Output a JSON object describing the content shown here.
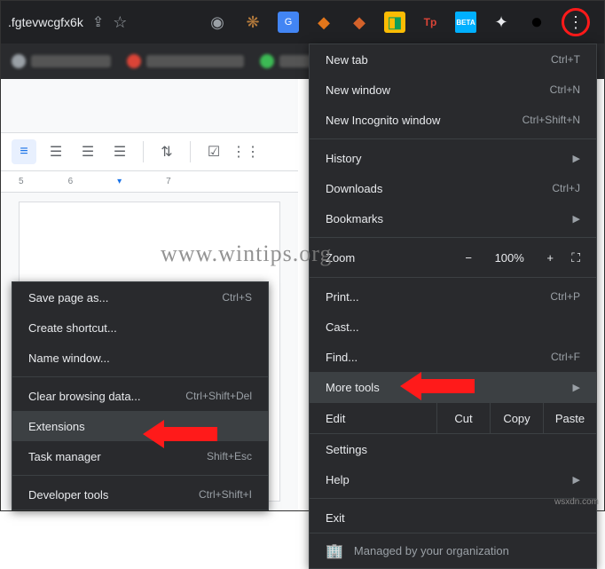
{
  "url": ".fgtevwcgfx6k",
  "extensions": [
    {
      "name": "camera-icon",
      "glyph": "📷",
      "color": "#9aa0a6"
    },
    {
      "name": "cookie-icon",
      "glyph": "🍪",
      "color": "#b57b3c"
    },
    {
      "name": "translate-icon",
      "glyph": "🔤",
      "color": "#4285f4"
    },
    {
      "name": "fox-icon",
      "glyph": "🦊",
      "color": "#e2761b"
    },
    {
      "name": "fox2-icon",
      "glyph": "🦊",
      "color": "#e2761b"
    },
    {
      "name": "mail-icon",
      "glyph": "✉",
      "color": "#0f9d58"
    },
    {
      "name": "tp-icon",
      "glyph": "Tp",
      "color": "#db4437"
    },
    {
      "name": "beta-icon",
      "glyph": "BETA",
      "color": "#00b0ff"
    },
    {
      "name": "puzzle-icon",
      "glyph": "✦",
      "color": "#e8eaed"
    },
    {
      "name": "profile-icon",
      "glyph": "●",
      "color": "#000"
    }
  ],
  "menu": {
    "new_tab": {
      "label": "New tab",
      "shortcut": "Ctrl+T"
    },
    "new_window": {
      "label": "New window",
      "shortcut": "Ctrl+N"
    },
    "new_incognito": {
      "label": "New Incognito window",
      "shortcut": "Ctrl+Shift+N"
    },
    "history": {
      "label": "History"
    },
    "downloads": {
      "label": "Downloads",
      "shortcut": "Ctrl+J"
    },
    "bookmarks": {
      "label": "Bookmarks"
    },
    "zoom": {
      "label": "Zoom",
      "value": "100%"
    },
    "print": {
      "label": "Print...",
      "shortcut": "Ctrl+P"
    },
    "cast": {
      "label": "Cast..."
    },
    "find": {
      "label": "Find...",
      "shortcut": "Ctrl+F"
    },
    "more_tools": {
      "label": "More tools"
    },
    "edit": {
      "label": "Edit",
      "cut": "Cut",
      "copy": "Copy",
      "paste": "Paste"
    },
    "settings": {
      "label": "Settings"
    },
    "help": {
      "label": "Help"
    },
    "exit": {
      "label": "Exit"
    },
    "managed": {
      "label": "Managed by your organization"
    }
  },
  "submenu": {
    "save_page": {
      "label": "Save page as...",
      "shortcut": "Ctrl+S"
    },
    "create_shortcut": {
      "label": "Create shortcut..."
    },
    "name_window": {
      "label": "Name window..."
    },
    "clear_data": {
      "label": "Clear browsing data...",
      "shortcut": "Ctrl+Shift+Del"
    },
    "extensions": {
      "label": "Extensions"
    },
    "task_manager": {
      "label": "Task manager",
      "shortcut": "Shift+Esc"
    },
    "dev_tools": {
      "label": "Developer tools",
      "shortcut": "Ctrl+Shift+I"
    }
  },
  "ruler": [
    "5",
    "6",
    "7"
  ],
  "watermark": "www.wintips.org",
  "corner": "wsxdn.com"
}
